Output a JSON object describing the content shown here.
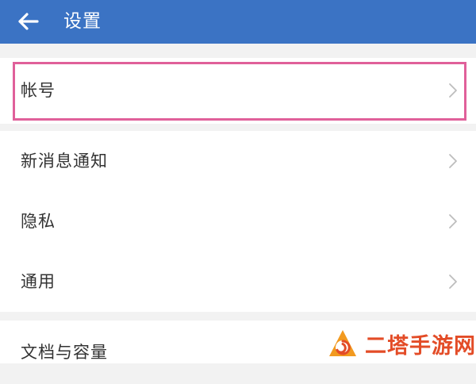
{
  "header": {
    "title": "设置",
    "background_color": "#3b73c4",
    "back_icon": "arrow-left-icon"
  },
  "settings": {
    "groups": [
      {
        "items": [
          {
            "label": "帐号",
            "highlighted": true
          }
        ]
      },
      {
        "items": [
          {
            "label": "新消息通知"
          },
          {
            "label": "隐私"
          },
          {
            "label": "通用"
          }
        ]
      },
      {
        "items": [
          {
            "label": "文档与容量"
          }
        ]
      }
    ],
    "chevron_icon": "chevron-right-icon",
    "highlight_color": "#e0609a"
  },
  "watermark": {
    "text": "二塔手游网",
    "color": "#e34c27",
    "logo_icon": "swirl-logo-icon"
  }
}
